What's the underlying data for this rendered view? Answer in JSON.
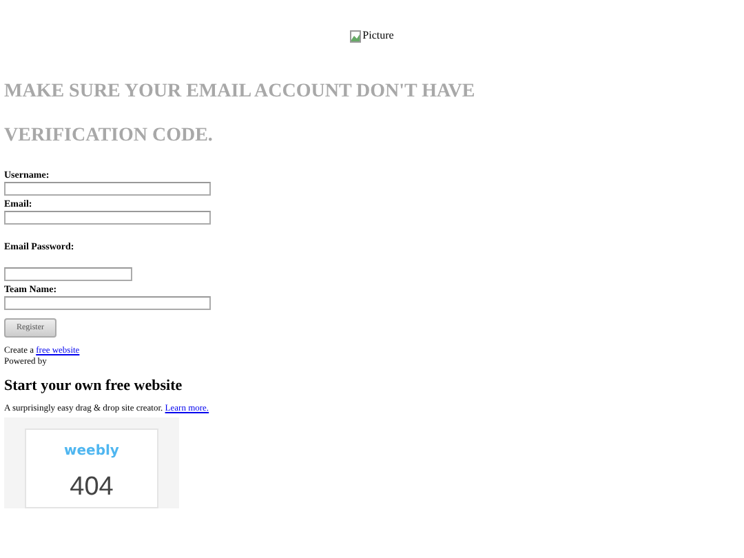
{
  "header_image": {
    "alt": "Picture"
  },
  "headline": [
    "MAKE SURE YOUR EMAIL ACCOUNT DON'T HAVE",
    "VERIFICATION CODE."
  ],
  "form": {
    "fields": [
      {
        "label": "Username:",
        "kind": "wide"
      },
      {
        "label": "Email:",
        "kind": "wide"
      },
      {
        "label": "Email Password:",
        "kind": "short"
      },
      {
        "label": "Team Name:",
        "kind": "wide"
      }
    ],
    "submit": "Register"
  },
  "footer": {
    "create_prefix": "Create a",
    "create_link": "free website",
    "powered_by": "Powered by",
    "promo_title": "Start your own free website",
    "promo_text": "A surprisingly easy drag & drop site creator.",
    "promo_link": "Learn more.",
    "preview": {
      "logo": "weebly",
      "code": "404"
    }
  }
}
